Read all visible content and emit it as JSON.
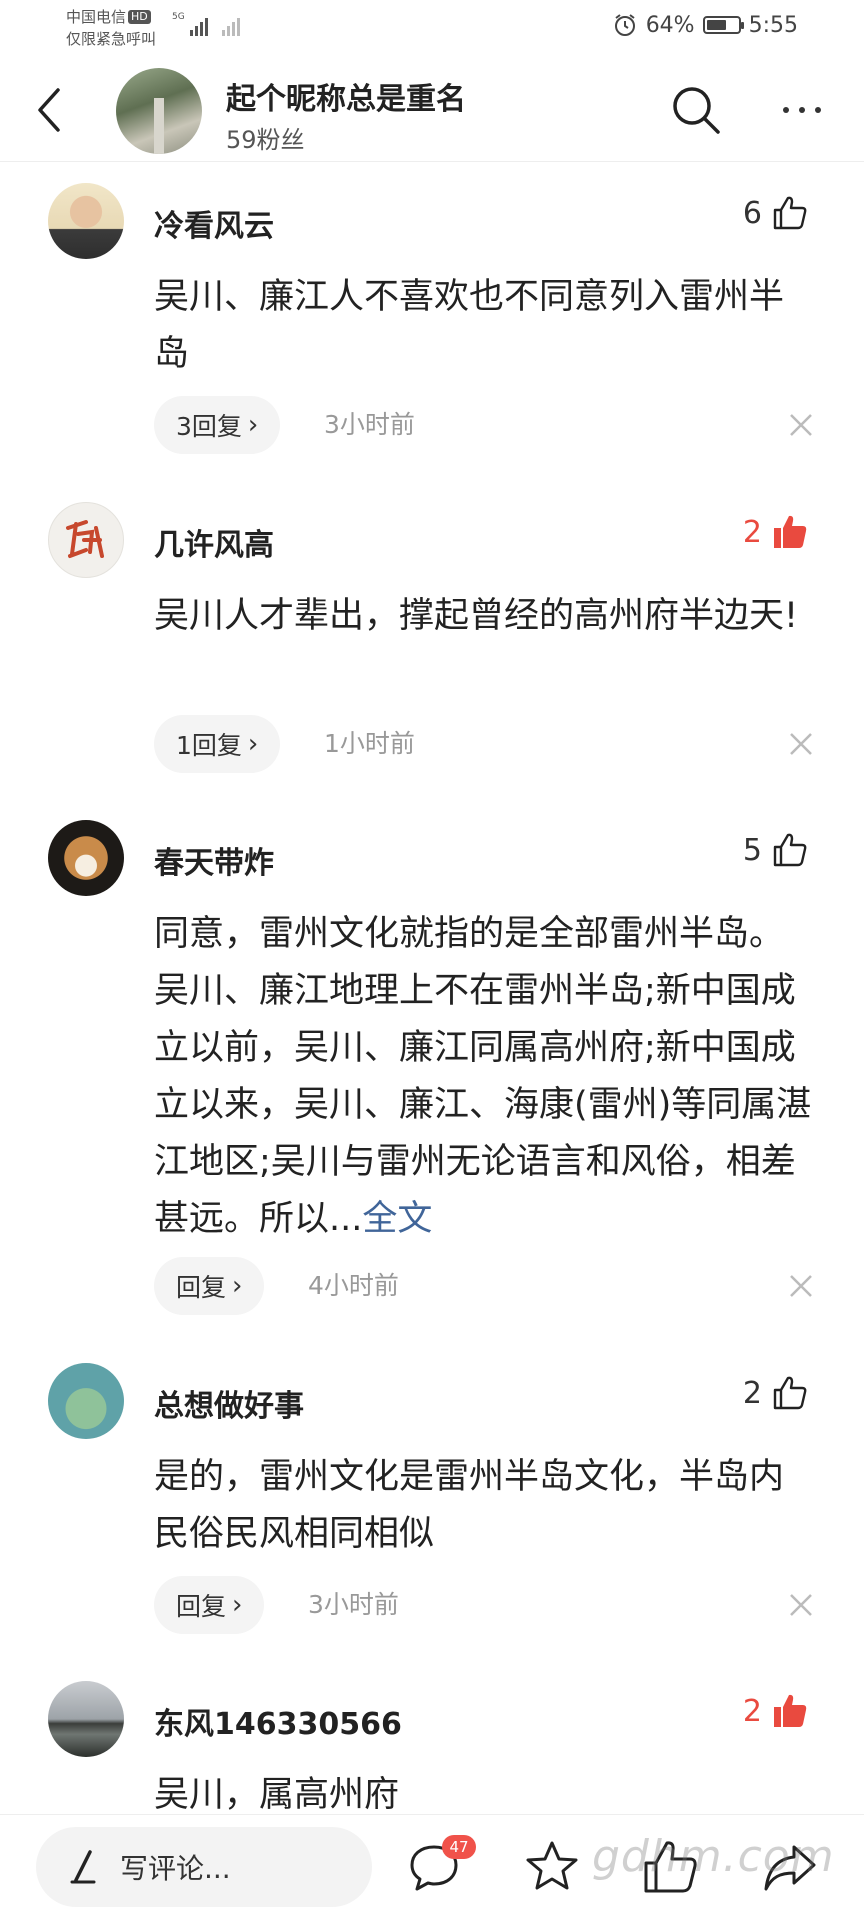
{
  "status_bar": {
    "carrier_line1": "中国电信",
    "hd_badge": "HD",
    "carrier_line2": "仅限紧急呼叫",
    "network": "5G",
    "battery_level": "64%",
    "time": "5:55"
  },
  "header": {
    "name": "起个昵称总是重名",
    "fans": "59粉丝"
  },
  "comments": [
    {
      "author": "冷看风云",
      "likes": "6",
      "liked": false,
      "text": "吴川、廉江人不喜欢也不同意列入雷州半岛",
      "reply_label": "3回复",
      "time": "3小时前"
    },
    {
      "author": "几许风高",
      "likes": "2",
      "liked": true,
      "text": "吴川人才辈出，撑起曾经的高州府半边天!",
      "reply_label": "1回复",
      "time": "1小时前"
    },
    {
      "author": "春天带炸",
      "likes": "5",
      "liked": false,
      "text": "同意，雷州文化就指的是全部雷州半岛。吴川、廉江地理上不在雷州半岛;新中国成立以前，吴川、廉江同属高州府;新中国成立以来，吴川、廉江、海康(雷州)等同属湛江地区;吴川与雷州无论语言和风俗，相差甚远。所以...",
      "full_text_link": "全文",
      "reply_label": "回复",
      "time": "4小时前"
    },
    {
      "author": "总想做好事",
      "likes": "2",
      "liked": false,
      "text": "是的，雷州文化是雷州半岛文化，半岛内民俗民风相同相似",
      "reply_label": "回复",
      "time": "3小时前"
    },
    {
      "author": "东风146330566",
      "likes": "2",
      "liked": true,
      "text": "吴川，属高州府"
    }
  ],
  "bottom_bar": {
    "write_placeholder": "写评论...",
    "comment_count": "47",
    "watermark": "gdhm.com"
  },
  "colors": {
    "liked_red": "#e94a3f",
    "link_blue": "#406599",
    "badge_red": "#f0524a"
  }
}
